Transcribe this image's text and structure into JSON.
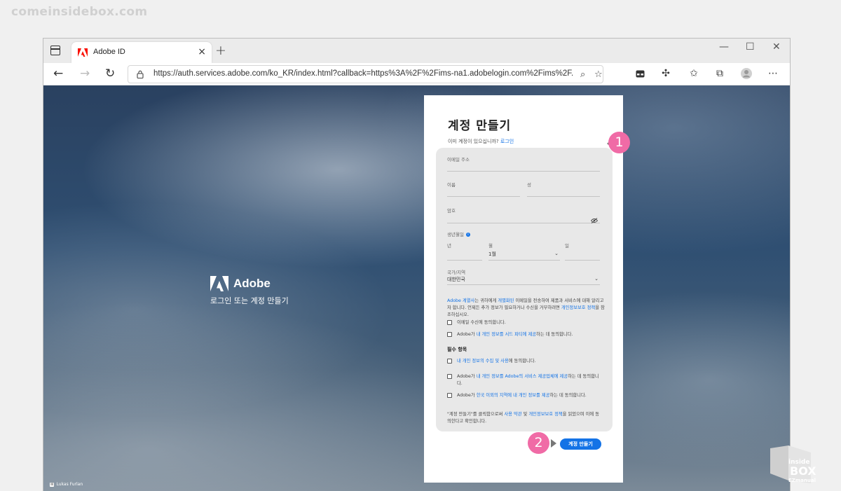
{
  "watermark": "comeinsidebox.com",
  "browser": {
    "tab_title": "Adobe ID",
    "tab_close": "×",
    "new_tab": "+",
    "url": "https://auth.services.adobe.com/ko_KR/index.html?callback=https%3A%2F%2Fims-na1.adobelogin.com%2Fims%2F...",
    "window_controls": {
      "minimize": "—",
      "maximize": "☐",
      "close": "✕"
    }
  },
  "background": {
    "brand_name": "Adobe",
    "brand_subtitle": "로그인 또는 계정 만들기",
    "credit_badge": "☒",
    "photo_credit": "Lukas Furlan"
  },
  "form": {
    "title": "계정 만들기",
    "already_text": "이미 계정이 있으십니까?",
    "login_link": "로그인",
    "email_label": "이메일 주소",
    "first_name_label": "이름",
    "last_name_label": "성",
    "password_label": "암호",
    "birth_label": "생년월일",
    "info_icon_text": "i",
    "year_label": "년",
    "month_label": "월",
    "month_value": "1월",
    "day_label": "일",
    "country_label": "국가/지역",
    "country_value": "대한민국",
    "notice_link1": "Adobe 계열사",
    "notice_text1": "는 귀하에게 ",
    "notice_link2": "개별화된",
    "notice_text2": " 이메일을 전송하여 제품과 서비스에 대해 알리고자 합니다. 언제든 추가 정보가 필요하거나 수신을 거부하려면 ",
    "notice_link3": "개인정보보호 정책",
    "notice_text3": "을 참조하십시오.",
    "cb_email": "이메일 수신에 동의합니다.",
    "cb_third_pre": "Adobe가 ",
    "cb_third_link": "내 개인 정보를 서드 파티에 제공",
    "cb_third_post": "하는 데 동의합니다.",
    "required_title": "필수 항목",
    "req1_link": "내 개인 정보의 수집 및 사용",
    "req1_post": "에 동의합니다.",
    "req2_pre": "Adobe가 ",
    "req2_link": "내 개인 정보를 Adobe의 서비스 제공업체에 제공",
    "req2_post": "하는 데 동의합니다.",
    "req3_pre": "Adobe가 ",
    "req3_link": "한국 이외의 지역에 내 개인 정보를 제공",
    "req3_post": "하는 데 동의합니다.",
    "legal_pre": "\"계정 만들기\"를 클릭함으로써 ",
    "legal_link1": "사용 약관",
    "legal_mid": " 및 ",
    "legal_link2": "개인정보보호 정책",
    "legal_post": "을 읽었으며 이에 동의한다고 확인합니다.",
    "submit_label": "계정 만들기"
  },
  "markers": {
    "m1": "1",
    "m2": "2"
  },
  "corner_logo": {
    "line1": "inside",
    "line2": "BOX",
    "line3": "EZmanual"
  },
  "colors": {
    "accent": "#1473e6",
    "marker": "#f06ba6",
    "adobe_red": "#fa0f00"
  }
}
